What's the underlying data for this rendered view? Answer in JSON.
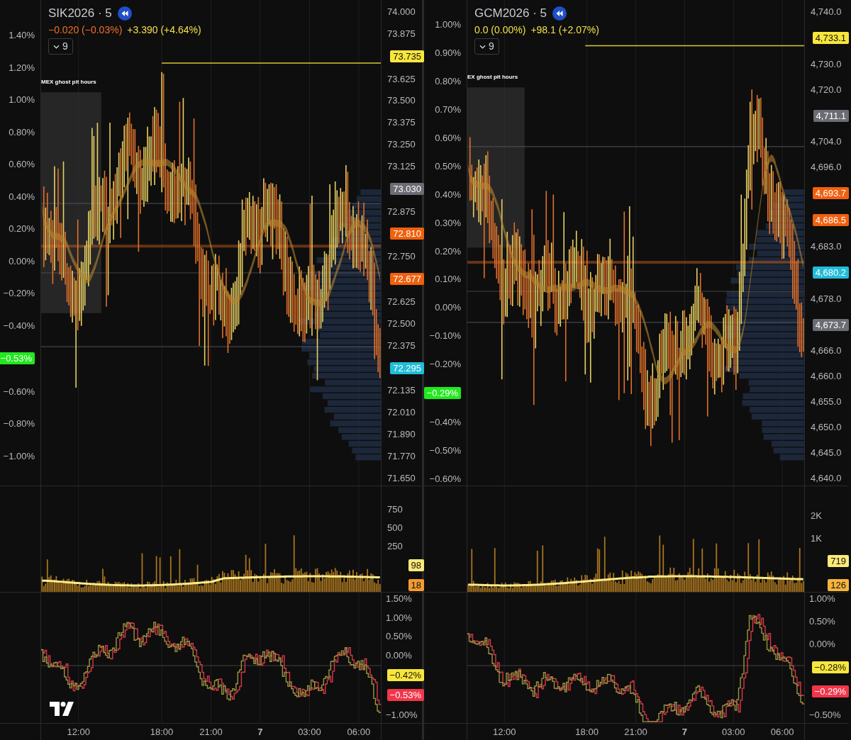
{
  "panels": [
    {
      "symbol": "SIK2026 · 5",
      "changes": [
        {
          "text": "−0.020 (−0.03%)",
          "color": "#f0702a"
        },
        {
          "text": "+3.390 (+4.64%)",
          "color": "#f2e04a"
        }
      ],
      "indicators_toggle": "9",
      "session_label": "MEX ghost pit hours",
      "logo": true,
      "percent_axis": [
        {
          "text": "1.40%",
          "kind": "tick"
        },
        {
          "text": "1.20%",
          "kind": "tick"
        },
        {
          "text": "1.00%",
          "kind": "tick"
        },
        {
          "text": "0.80%",
          "kind": "tick"
        },
        {
          "text": "0.60%",
          "kind": "tick"
        },
        {
          "text": "0.40%",
          "kind": "tick"
        },
        {
          "text": "0.20%",
          "kind": "tick"
        },
        {
          "text": "0.00%",
          "kind": "tick"
        },
        {
          "text": "−0.20%",
          "kind": "tick"
        },
        {
          "text": "−0.40%",
          "kind": "tick"
        },
        {
          "text": "−0.53%",
          "kind": "badge",
          "color": "#22e81e"
        },
        {
          "text": "−0.60%",
          "kind": "tick"
        },
        {
          "text": "−0.80%",
          "kind": "tick"
        },
        {
          "text": "−1.00%",
          "kind": "tick"
        }
      ],
      "price_axis": [
        {
          "text": "74.000",
          "kind": "tick"
        },
        {
          "text": "73.875",
          "kind": "tick"
        },
        {
          "text": "73.735",
          "kind": "badge",
          "color": "#f8e63c"
        },
        {
          "text": "73.625",
          "kind": "tick"
        },
        {
          "text": "73.500",
          "kind": "tick"
        },
        {
          "text": "73.375",
          "kind": "tick"
        },
        {
          "text": "73.250",
          "kind": "tick"
        },
        {
          "text": "73.125",
          "kind": "tick"
        },
        {
          "text": "73.030",
          "kind": "badge",
          "color": "#6b6c74"
        },
        {
          "text": "72.875",
          "kind": "tick"
        },
        {
          "text": "72.810",
          "kind": "badge",
          "color": "#f0600e"
        },
        {
          "text": "72.750",
          "kind": "tick"
        },
        {
          "text": "72.677",
          "kind": "badge",
          "color": "#f0600e"
        },
        {
          "text": "72.625",
          "kind": "tick"
        },
        {
          "text": "72.500",
          "kind": "tick"
        },
        {
          "text": "72.375",
          "kind": "tick"
        },
        {
          "text": "72.295",
          "kind": "badge",
          "color": "#22bcd8"
        },
        {
          "text": "72.135",
          "kind": "tick"
        },
        {
          "text": "72.010",
          "kind": "tick"
        },
        {
          "text": "71.890",
          "kind": "tick"
        },
        {
          "text": "71.770",
          "kind": "tick"
        },
        {
          "text": "71.650",
          "kind": "tick"
        }
      ],
      "volume_axis": [
        {
          "text": "750",
          "kind": "tick"
        },
        {
          "text": "500",
          "kind": "tick"
        },
        {
          "text": "250",
          "kind": "tick"
        },
        {
          "text": "98",
          "kind": "badge",
          "color": "#fbe97a"
        },
        {
          "text": "18",
          "kind": "badge",
          "color": "#f49a30"
        }
      ],
      "oscillator_axis": [
        {
          "text": "1.50%",
          "kind": "tick"
        },
        {
          "text": "1.00%",
          "kind": "tick"
        },
        {
          "text": "0.50%",
          "kind": "tick"
        },
        {
          "text": "0.00%",
          "kind": "tick"
        },
        {
          "text": "−0.42%",
          "kind": "badge",
          "color": "#f8e63c"
        },
        {
          "text": "−0.53%",
          "kind": "badge",
          "color": "#f2364a"
        },
        {
          "text": "−1.00%",
          "kind": "tick"
        }
      ],
      "time_axis": [
        {
          "text": "12:00",
          "bold": false
        },
        {
          "text": "18:00",
          "bold": false
        },
        {
          "text": "21:00",
          "bold": false
        },
        {
          "text": "7",
          "bold": true
        },
        {
          "text": "03:00",
          "bold": false
        },
        {
          "text": "06:00",
          "bold": false
        }
      ]
    },
    {
      "symbol": "GCM2026 · 5",
      "changes": [
        {
          "text": "0.0 (0.00%)",
          "color": "#f2e04a"
        },
        {
          "text": "+98.1 (+2.07%)",
          "color": "#f2e04a"
        }
      ],
      "indicators_toggle": "9",
      "session_label": "EX ghost pit hours",
      "logo": false,
      "percent_axis": [
        {
          "text": "1.00%",
          "kind": "tick"
        },
        {
          "text": "0.90%",
          "kind": "tick"
        },
        {
          "text": "0.80%",
          "kind": "tick"
        },
        {
          "text": "0.70%",
          "kind": "tick"
        },
        {
          "text": "0.60%",
          "kind": "tick"
        },
        {
          "text": "0.50%",
          "kind": "tick"
        },
        {
          "text": "0.40%",
          "kind": "tick"
        },
        {
          "text": "0.30%",
          "kind": "tick"
        },
        {
          "text": "0.20%",
          "kind": "tick"
        },
        {
          "text": "0.10%",
          "kind": "tick"
        },
        {
          "text": "0.00%",
          "kind": "tick"
        },
        {
          "text": "−0.10%",
          "kind": "tick"
        },
        {
          "text": "−0.20%",
          "kind": "tick"
        },
        {
          "text": "−0.29%",
          "kind": "badge",
          "color": "#22e81e"
        },
        {
          "text": "−0.40%",
          "kind": "tick"
        },
        {
          "text": "−0.50%",
          "kind": "tick"
        },
        {
          "text": "−0.60%",
          "kind": "tick"
        }
      ],
      "price_axis": [
        {
          "text": "4,740.0",
          "kind": "tick"
        },
        {
          "text": "4,733.1",
          "kind": "badge",
          "color": "#f8e63c"
        },
        {
          "text": "4,730.0",
          "kind": "tick"
        },
        {
          "text": "4,720.0",
          "kind": "tick"
        },
        {
          "text": "4,711.1",
          "kind": "badge",
          "color": "#6b6c74"
        },
        {
          "text": "4,704.0",
          "kind": "tick"
        },
        {
          "text": "4,696.0",
          "kind": "tick"
        },
        {
          "text": "4,693.7",
          "kind": "badge",
          "color": "#f0600e"
        },
        {
          "text": "4,686.5",
          "kind": "badge",
          "color": "#f0600e"
        },
        {
          "text": "4,683.0",
          "kind": "tick"
        },
        {
          "text": "4,680.2",
          "kind": "badge",
          "color": "#22bcd8"
        },
        {
          "text": "4,678.0",
          "kind": "tick"
        },
        {
          "text": "4,673.7",
          "kind": "badge",
          "color": "#6b6c74"
        },
        {
          "text": "4,666.0",
          "kind": "tick"
        },
        {
          "text": "4,660.0",
          "kind": "tick"
        },
        {
          "text": "4,655.0",
          "kind": "tick"
        },
        {
          "text": "4,650.0",
          "kind": "tick"
        },
        {
          "text": "4,645.0",
          "kind": "tick"
        },
        {
          "text": "4,640.0",
          "kind": "tick"
        }
      ],
      "volume_axis": [
        {
          "text": "2K",
          "kind": "tick"
        },
        {
          "text": "1K",
          "kind": "tick"
        },
        {
          "text": "719",
          "kind": "badge",
          "color": "#fbe97a"
        },
        {
          "text": "126",
          "kind": "badge",
          "color": "#f5b43a"
        }
      ],
      "oscillator_axis": [
        {
          "text": "1.00%",
          "kind": "tick"
        },
        {
          "text": "0.50%",
          "kind": "tick"
        },
        {
          "text": "0.00%",
          "kind": "tick"
        },
        {
          "text": "−0.28%",
          "kind": "badge",
          "color": "#f8e63c"
        },
        {
          "text": "−0.29%",
          "kind": "badge",
          "color": "#f2364a"
        },
        {
          "text": "−0.50%",
          "kind": "tick"
        }
      ],
      "time_axis": [
        {
          "text": "12:00",
          "bold": false
        },
        {
          "text": "18:00",
          "bold": false
        },
        {
          "text": "21:00",
          "bold": false
        },
        {
          "text": "7",
          "bold": true
        },
        {
          "text": "03:00",
          "bold": false
        },
        {
          "text": "06:00",
          "bold": false
        }
      ]
    }
  ]
}
